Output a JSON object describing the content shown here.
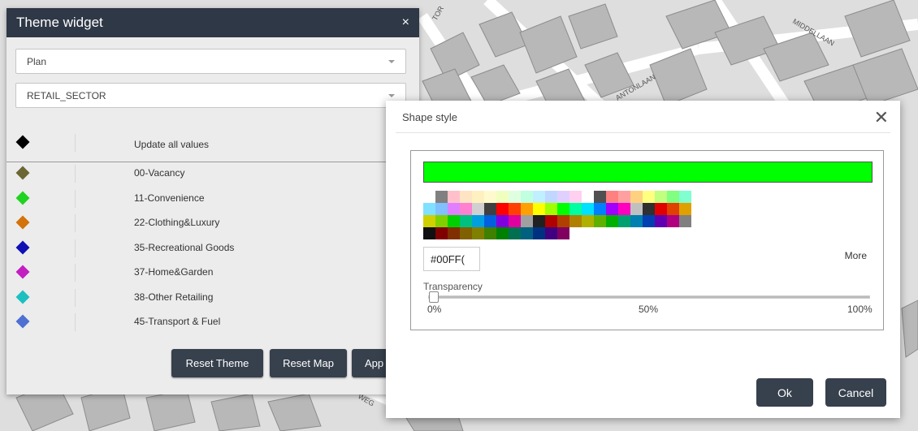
{
  "map": {
    "streets": [
      "TOR",
      "ANTONLAAN",
      "MIDDELLAAN",
      "WEG"
    ]
  },
  "theme_widget": {
    "title": "Theme widget",
    "close_glyph": "×",
    "select_plan": "Plan",
    "select_field": "RETAIL_SECTOR",
    "update_all_label": "Update all values",
    "items": [
      {
        "label": "00-Vacancy",
        "color": "#6b6633"
      },
      {
        "label": "11-Convenience",
        "color": "#1fd31f"
      },
      {
        "label": "22-Clothing&Luxury",
        "color": "#d4720c"
      },
      {
        "label": "35-Recreational Goods",
        "color": "#1010b4"
      },
      {
        "label": "37-Home&Garden",
        "color": "#c21ec2"
      },
      {
        "label": "38-Other Retailing",
        "color": "#1dbfbf"
      },
      {
        "label": "45-Transport & Fuel",
        "color": "#4f6fd3"
      }
    ],
    "update_all_color": "#000000",
    "buttons": {
      "reset_theme": "Reset Theme",
      "reset_map": "Reset Map",
      "apply": "App"
    }
  },
  "shape_style": {
    "title": "Shape style",
    "close_glyph": "✕",
    "selected_color": "#00ff00",
    "hex_value": "#00FF(",
    "more_label": "More",
    "transparency_label": "Transparency",
    "transparency_value": 0,
    "tick_labels": [
      "0%",
      "50%",
      "100%"
    ],
    "ok_label": "Ok",
    "cancel_label": "Cancel"
  },
  "palette_rows": [
    [
      "#ffffff",
      "#808080",
      "#ffc0cb",
      "#ffe4c4",
      "#fff0c0",
      "#fffacd",
      "#f0ffc0",
      "#e0ffe0",
      "#c0ffe0",
      "#c0f0ff",
      "#c0d8ff",
      "#e0d0ff",
      "#ffd0f0",
      "#ffffff",
      "#505050",
      "#ff8080",
      "#ffa0a0",
      "#ffd080",
      "#ffff80",
      "#c0ff80",
      "#80ff80",
      "#80ffd0"
    ],
    [
      "#80e0ff",
      "#80c0ff",
      "#e080ff",
      "#ff80d0",
      "#d0d0d0",
      "#404040",
      "#ff0000",
      "#ff4000",
      "#ffa000",
      "#ffff00",
      "#a0ff00",
      "#00ff00",
      "#00ffa0",
      "#00e0ff",
      "#0080ff",
      "#a000ff",
      "#ff00c0",
      "#c0c0c0",
      "#303030",
      "#e00000",
      "#e04000",
      "#e0a000"
    ],
    [
      "#d0d000",
      "#80d000",
      "#00d000",
      "#00c080",
      "#00a0e0",
      "#0060e0",
      "#8000e0",
      "#e000a0",
      "#a0a0a0",
      "#202020",
      "#b00000",
      "#b04000",
      "#b08000",
      "#b0b000",
      "#60b000",
      "#00b000",
      "#00a070",
      "#0080b0",
      "#0040b0",
      "#6000b0",
      "#b00080",
      "#808080"
    ],
    [
      "#101010",
      "#800000",
      "#803000",
      "#806000",
      "#808000",
      "#408000",
      "#008000",
      "#007050",
      "#006080",
      "#003080",
      "#400080",
      "#800060"
    ]
  ]
}
